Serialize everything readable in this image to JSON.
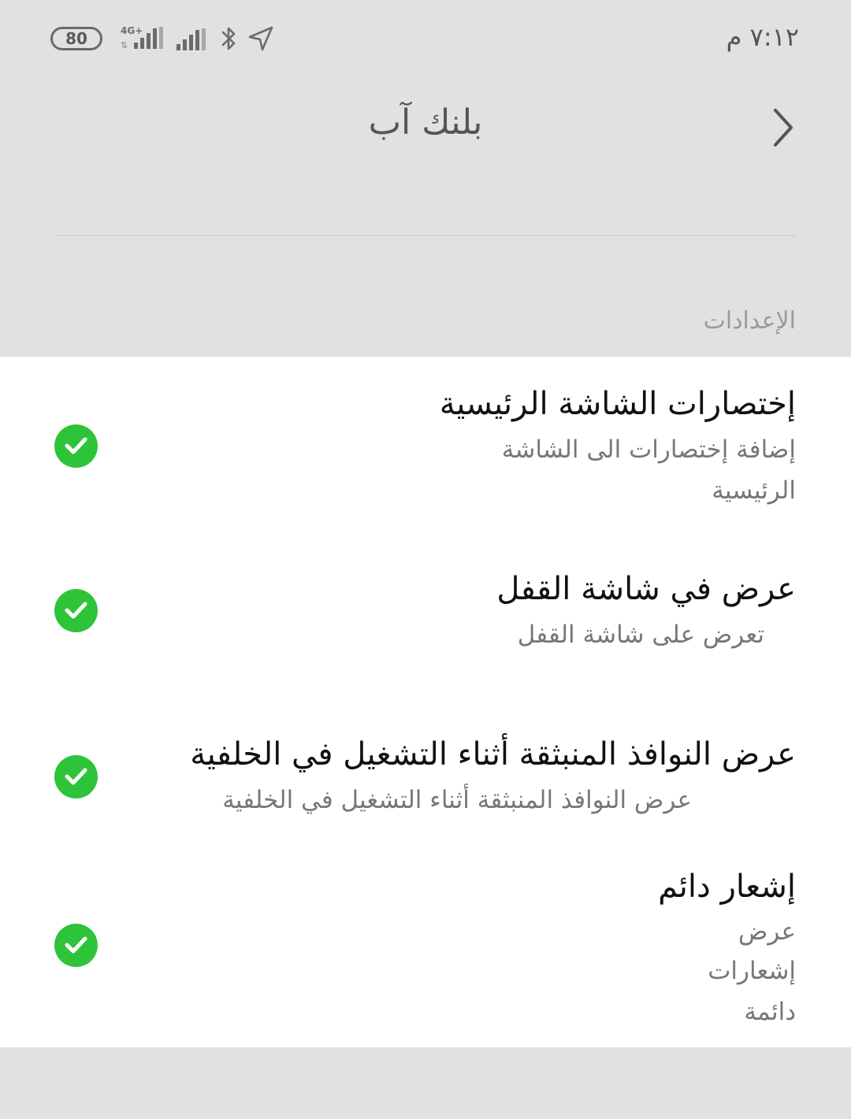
{
  "status_bar": {
    "battery": "80",
    "network": "4G+",
    "time": "٧:١٢ م"
  },
  "header": {
    "title": "بلنك آب"
  },
  "section": {
    "label": "الإعدادات"
  },
  "settings": [
    {
      "title": "إختصارات الشاشة الرئيسية",
      "subtitle_lines": [
        "إضافة إختصارات الى الشاشة",
        "الرئيسية"
      ],
      "checked": true
    },
    {
      "title": "عرض في شاشة القفل",
      "subtitle_lines": [
        "تعرض على شاشة القفل"
      ],
      "checked": true
    },
    {
      "title": "عرض النوافذ المنبثقة أثناء التشغيل في الخلفية",
      "subtitle_lines": [
        "عرض النوافذ المنبثقة أثناء التشغيل في الخلفية"
      ],
      "checked": true
    },
    {
      "title": "إشعار دائم",
      "subtitle_lines": [
        "عرض",
        "إشعارات",
        "دائمة"
      ],
      "checked": true
    }
  ],
  "colors": {
    "check": "#2ec43a",
    "background": "#e1e1e1",
    "card": "#ffffff"
  }
}
